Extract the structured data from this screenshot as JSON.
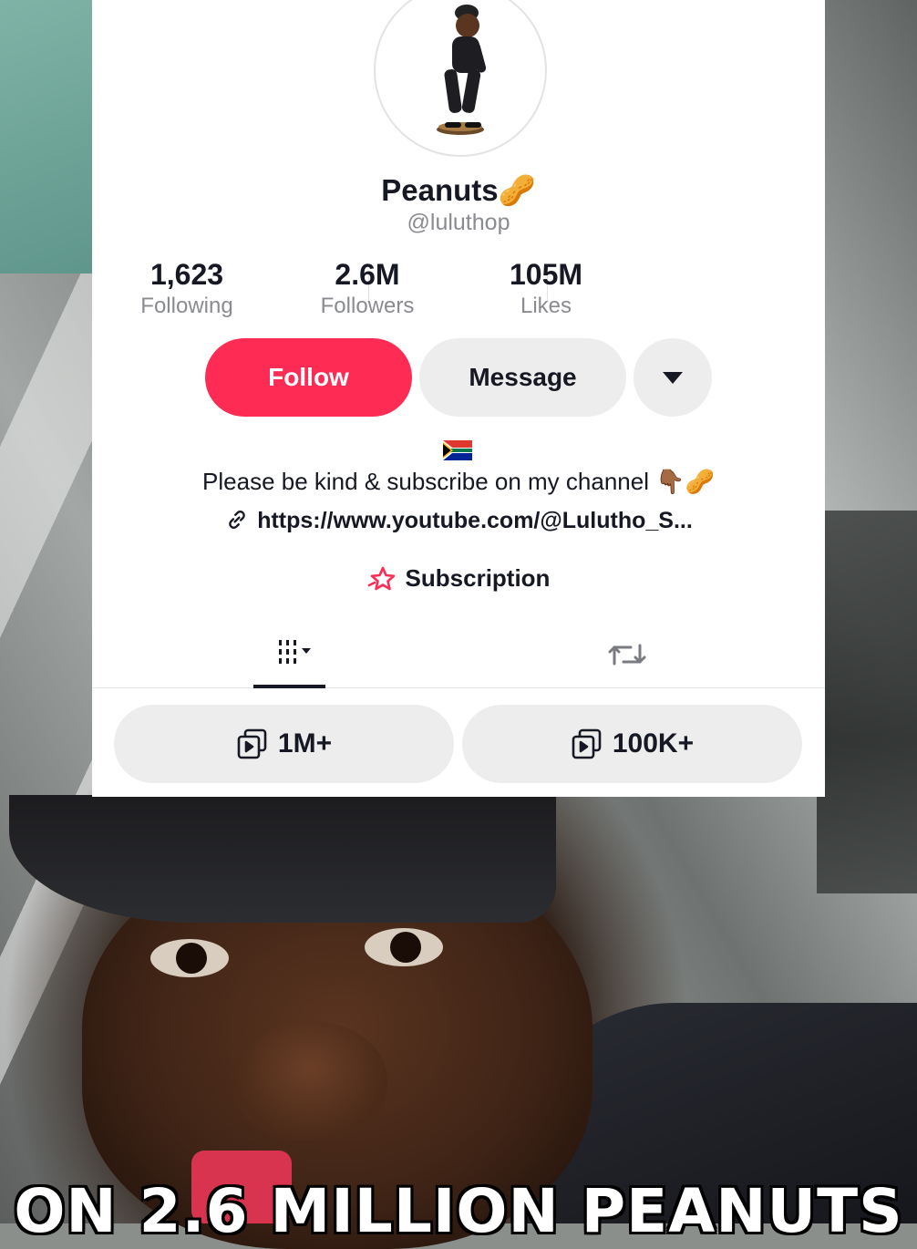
{
  "profile": {
    "display_name": "Peanuts🥜",
    "username": "@luluthop"
  },
  "stats": [
    {
      "value": "1,623",
      "label": "Following"
    },
    {
      "value": "2.6M",
      "label": "Followers"
    },
    {
      "value": "105M",
      "label": "Likes"
    }
  ],
  "actions": {
    "follow_label": "Follow",
    "message_label": "Message",
    "more_icon": "caret-down-icon"
  },
  "bio": {
    "flag": "🇿🇦",
    "text": "Please be kind & subscribe on my channel 👇🏾🥜",
    "link": "https://www.youtube.com/@Lulutho_S..."
  },
  "subscription": {
    "label": "Subscription",
    "icon": "star-icon"
  },
  "tabs": [
    {
      "icon": "grid-icon",
      "selected": true
    },
    {
      "icon": "repost-icon",
      "selected": false
    }
  ],
  "highlights": [
    {
      "icon": "playlist-icon",
      "label": "1M+"
    },
    {
      "icon": "playlist-icon",
      "label": "100K+"
    }
  ],
  "video_caption": "ON 2.6 MILLION PEANUTS",
  "colors": {
    "follow_button": "#fe2c55",
    "accent_star": "#fe2c55",
    "text_primary": "#161823",
    "text_secondary": "#8a8b91"
  }
}
